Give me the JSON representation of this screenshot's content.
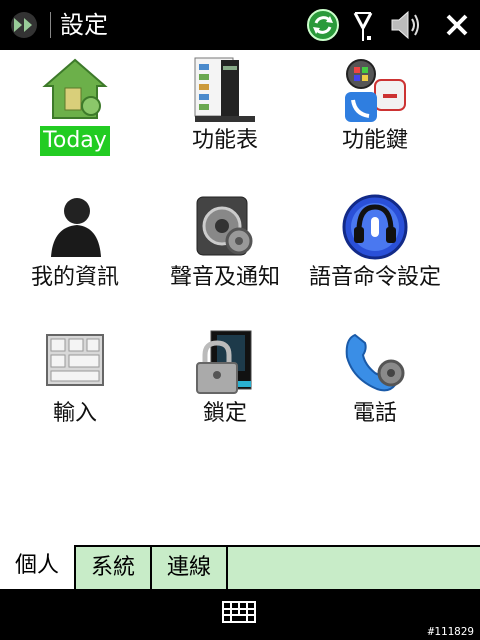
{
  "topbar": {
    "title": "設定",
    "icons": [
      "start-icon",
      "sync-icon",
      "signal-icon",
      "volume-icon",
      "close-icon"
    ]
  },
  "grid": {
    "items": [
      {
        "label": "Today",
        "icon": "today-house-icon",
        "selected": true
      },
      {
        "label": "功能表",
        "icon": "menu-icon",
        "selected": false
      },
      {
        "label": "功能鍵",
        "icon": "buttons-icon",
        "selected": false
      },
      {
        "label": "我的資訊",
        "icon": "owner-info-icon",
        "selected": false
      },
      {
        "label": "聲音及通知",
        "icon": "sounds-icon",
        "selected": false
      },
      {
        "label": "語音命令設定",
        "icon": "voice-command-icon",
        "selected": false
      },
      {
        "label": "輸入",
        "icon": "input-icon",
        "selected": false
      },
      {
        "label": "鎖定",
        "icon": "lock-icon",
        "selected": false
      },
      {
        "label": "電話",
        "icon": "phone-icon",
        "selected": false
      }
    ]
  },
  "tabs": [
    {
      "label": "個人",
      "active": true
    },
    {
      "label": "系統",
      "active": false
    },
    {
      "label": "連線",
      "active": false
    }
  ],
  "bottombar": {
    "icon": "keyboard-icon"
  },
  "watermark": "#111829",
  "colors": {
    "selection": "#22cc22",
    "tab_bg": "#c8ecc8",
    "bar_bg": "#000000"
  }
}
